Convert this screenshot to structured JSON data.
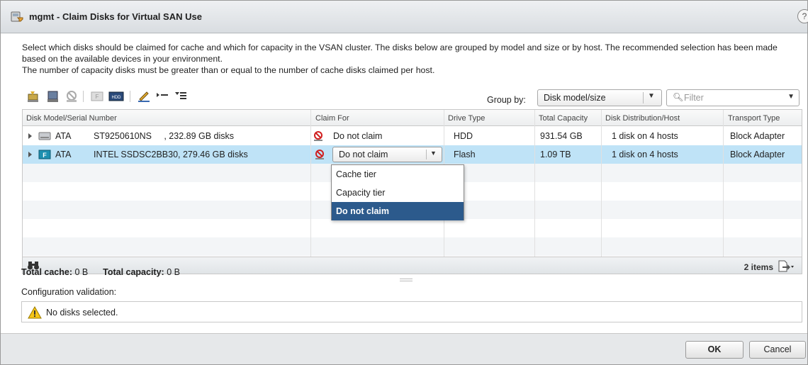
{
  "window": {
    "title": "mgmt - Claim Disks for Virtual SAN Use",
    "help_label": "?"
  },
  "description": {
    "line1": "Select which disks should be claimed for cache and which for capacity in the VSAN cluster. The disks below are grouped by model and size or by host. The recommended selection has been made based on the available devices in your environment.",
    "line2": "The number of capacity disks must be greater than or equal to the number of cache disks claimed per host."
  },
  "toolbar": {
    "group_by_label": "Group by:",
    "group_by_value": "Disk model/size",
    "filter_placeholder": "Filter",
    "icons": [
      "claim-cache-icon",
      "claim-capacity-icon",
      "do-not-claim-icon",
      "flash-marker-icon",
      "hdd-marker-icon",
      "edit-icon",
      "expand-all-icon",
      "collapse-all-icon"
    ]
  },
  "table": {
    "columns": [
      "Disk Model/Serial Number",
      "Claim For",
      "Drive Type",
      "Total Capacity",
      "Disk Distribution/Host",
      "Transport Type"
    ],
    "rows": [
      {
        "vendor": "ATA",
        "model": "ST9250610NS     , 232.89 GB disks",
        "claim_for": "Do not claim",
        "drive_type": "HDD",
        "total_capacity": "931.54 GB",
        "distribution": "1 disk on 4 hosts",
        "transport": "Block Adapter",
        "icon": "hdd-disk-icon"
      },
      {
        "vendor": "ATA",
        "model": "INTEL SSDSC2BB30, 279.46 GB disks",
        "claim_for": "Do not claim",
        "drive_type": "Flash",
        "total_capacity": "1.09 TB",
        "distribution": "1 disk on 4 hosts",
        "transport": "Block Adapter",
        "icon": "flash-disk-icon",
        "selected": true
      }
    ],
    "claim_options": [
      "Cache tier",
      "Capacity tier",
      "Do not claim"
    ],
    "selected_option": "Do not claim",
    "item_count": "2 items"
  },
  "totals": {
    "cache_label": "Total cache:",
    "cache_value": "0 B",
    "capacity_label": "Total capacity:",
    "capacity_value": "0 B"
  },
  "validation": {
    "label": "Configuration validation:",
    "message": "No disks selected."
  },
  "buttons": {
    "ok": "OK",
    "cancel": "Cancel"
  },
  "colors": {
    "selected_row": "#bfe3f7",
    "active_menu_item": "#2c5a8c",
    "flash_badge": "#1d8fb0"
  }
}
